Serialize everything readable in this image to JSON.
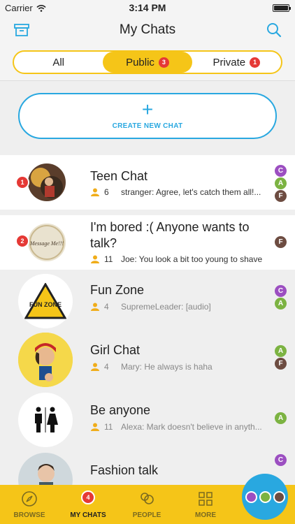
{
  "status": {
    "carrier": "Carrier",
    "time": "3:14 PM"
  },
  "nav": {
    "title": "My Chats",
    "left_icon": "archive-icon",
    "right_icon": "search-icon"
  },
  "segments": [
    {
      "label": "All",
      "badge": ""
    },
    {
      "label": "Public",
      "badge": "3",
      "active": true
    },
    {
      "label": "Private",
      "badge": "1"
    }
  ],
  "create": {
    "plus": "+",
    "label": "CREATE NEW CHAT"
  },
  "chats": [
    {
      "title": "Teen Chat",
      "members": "6",
      "last": "stranger: Agree, let's catch them all!...",
      "unread": "1",
      "letters": [
        "C",
        "A",
        "F"
      ]
    },
    {
      "title": "I'm bored :( Anyone wants to talk?",
      "members": "11",
      "last": "Joe: You look a bit too young to shave",
      "unread": "2",
      "letters": [
        "F"
      ],
      "avatar_text": "Message Me!!!"
    },
    {
      "title": "Fun Zone",
      "members": "4",
      "last": "SupremeLeader: [audio]",
      "letters": [
        "C",
        "A"
      ],
      "avatar_text": "FUN ZONE"
    },
    {
      "title": "Girl Chat",
      "members": "4",
      "last": "Mary: He always is haha",
      "letters": [
        "A",
        "F"
      ]
    },
    {
      "title": "Be anyone",
      "members": "11",
      "last": "Alexa: Mark doesn't believe in anyth...",
      "letters": [
        "A"
      ]
    },
    {
      "title": "Fashion talk",
      "members": "",
      "last": "",
      "letters": [
        "C"
      ]
    }
  ],
  "letter_colors": {
    "C": "#9c4fc1",
    "A": "#7cb342",
    "F": "#6d4c41"
  },
  "tabs": [
    {
      "label": "BROWSE",
      "icon": "compass-icon"
    },
    {
      "label": "MY CHATS",
      "icon": "chat-icon",
      "badge": "4",
      "active": true
    },
    {
      "label": "PEOPLE",
      "icon": "people-icon"
    },
    {
      "label": "MORE",
      "icon": "grid-icon"
    }
  ],
  "fab_colors": [
    "#9c4fc1",
    "#7cb342",
    "#6d4c41"
  ],
  "colors": {
    "accent_yellow": "#f5c518",
    "accent_blue": "#29a8e0",
    "badge_red": "#e53935"
  }
}
